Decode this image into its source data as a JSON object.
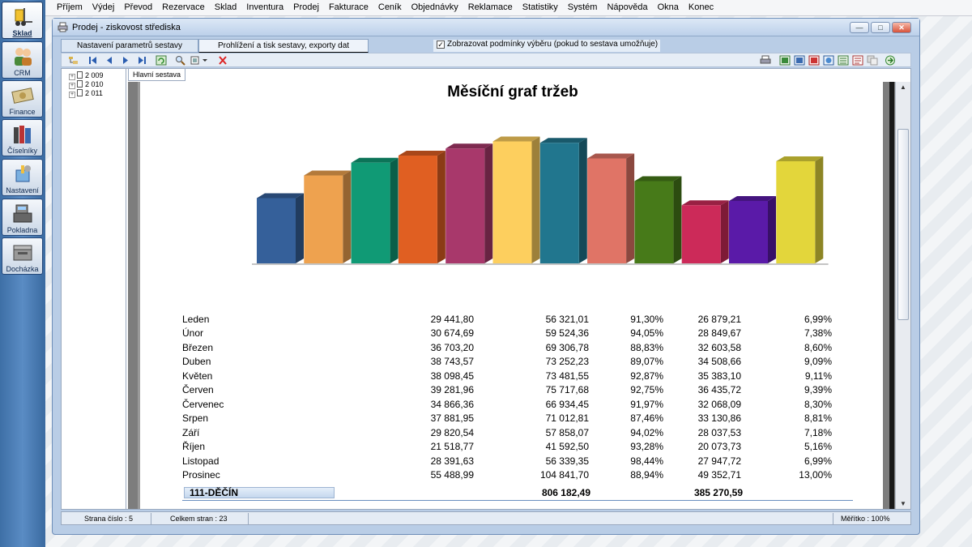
{
  "launcher": [
    {
      "label": "Sklad",
      "icon": "forklift-icon",
      "active": true
    },
    {
      "label": "CRM",
      "icon": "people-icon",
      "active": false
    },
    {
      "label": "Finance",
      "icon": "money-icon",
      "active": false
    },
    {
      "label": "Číselníky",
      "icon": "books-icon",
      "active": false
    },
    {
      "label": "Nastavení",
      "icon": "tools-icon",
      "active": false
    },
    {
      "label": "Pokladna",
      "icon": "cash-register-icon",
      "active": false
    },
    {
      "label": "Docházka",
      "icon": "time-clock-icon",
      "active": false
    }
  ],
  "menu": [
    "Příjem",
    "Výdej",
    "Převod",
    "Rezervace",
    "Sklad",
    "Inventura",
    "Prodej",
    "Fakturace",
    "Ceník",
    "Objednávky",
    "Reklamace",
    "Statistiky",
    "Systém",
    "Nápověda",
    "Okna",
    "Konec"
  ],
  "window": {
    "title": "Prodej - ziskovost střediska"
  },
  "tabs": [
    "Nastavení parametrů sestavy",
    "Prohlížení a tisk sestavy, exporty dat"
  ],
  "condition_checkbox": {
    "label": "Zobrazovat podmínky výběru (pokud to sestava umožňuje)",
    "checked": true
  },
  "tree": [
    "2 009",
    "2 010",
    "2 011"
  ],
  "report_tab": "Hlavní sestava",
  "chart_data": {
    "type": "bar",
    "title": "Měsíční graf tržeb",
    "categories": [
      "Leden",
      "Únor",
      "Březen",
      "Duben",
      "Květen",
      "Červen",
      "Červenec",
      "Srpen",
      "Září",
      "Říjen",
      "Listopad",
      "Prosinec"
    ],
    "values": [
      29441.8,
      30674.69,
      36703.2,
      38743.57,
      38098.45,
      39281.96,
      34866.36,
      37881.95,
      29820.54,
      21518.77,
      28391.63,
      55488.99
    ],
    "colors": [
      "#35609a",
      "#eea24f",
      "#109a75",
      "#e05f22",
      "#a8386b",
      "#fdcf5e",
      "#21768e",
      "#e07466",
      "#477a19",
      "#cc2a59",
      "#5a1aa8",
      "#e3d63b"
    ],
    "heights_shown": [
      0.46,
      0.62,
      0.71,
      0.76,
      0.81,
      0.86,
      0.85,
      0.74,
      0.58,
      0.41,
      0.44,
      0.72
    ],
    "xlabel": "",
    "ylabel": "",
    "legend": "none",
    "grid": false,
    "style": "3d"
  },
  "table": {
    "rows": [
      [
        "Leden",
        "29 441,80",
        "56 321,01",
        "91,30%",
        "26 879,21",
        "6,99%"
      ],
      [
        "Únor",
        "30 674,69",
        "59 524,36",
        "94,05%",
        "28 849,67",
        "7,38%"
      ],
      [
        "Březen",
        "36 703,20",
        "69 306,78",
        "88,83%",
        "32 603,58",
        "8,60%"
      ],
      [
        "Duben",
        "38 743,57",
        "73 252,23",
        "89,07%",
        "34 508,66",
        "9,09%"
      ],
      [
        "Květen",
        "38 098,45",
        "73 481,55",
        "92,87%",
        "35 383,10",
        "9,11%"
      ],
      [
        "Červen",
        "39 281,96",
        "75 717,68",
        "92,75%",
        "36 435,72",
        "9,39%"
      ],
      [
        "Červenec",
        "34 866,36",
        "66 934,45",
        "91,97%",
        "32 068,09",
        "8,30%"
      ],
      [
        "Srpen",
        "37 881,95",
        "71 012,81",
        "87,46%",
        "33 130,86",
        "8,81%"
      ],
      [
        "Září",
        "29 820,54",
        "57 858,07",
        "94,02%",
        "28 037,53",
        "7,18%"
      ],
      [
        "Říjen",
        "21 518,77",
        "41 592,50",
        "93,28%",
        "20 073,73",
        "5,16%"
      ],
      [
        "Listopad",
        "28 391,63",
        "56 339,35",
        "98,44%",
        "27 947,72",
        "6,99%"
      ],
      [
        "Prosinec",
        "55 488,99",
        "104 841,70",
        "88,94%",
        "49 352,71",
        "13,00%"
      ]
    ],
    "summary": {
      "name": "111-DĚČÍN",
      "total1": "806 182,49",
      "total2": "385 270,59"
    }
  },
  "status": {
    "page": "Strana číslo : 5",
    "pages": "Celkem stran : 23",
    "zoom": "Měřítko : 100%"
  }
}
